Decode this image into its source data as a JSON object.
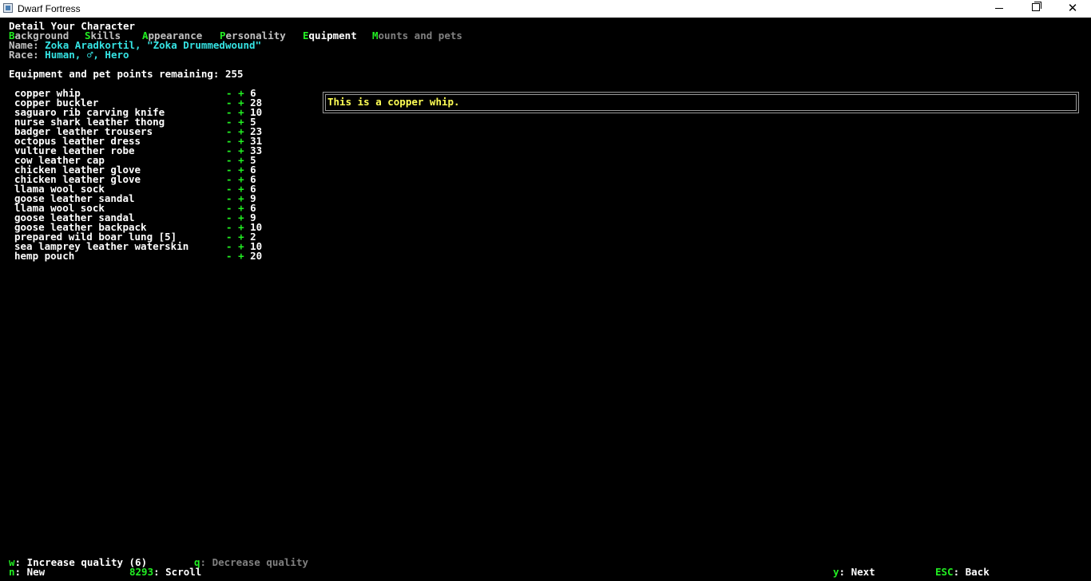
{
  "window": {
    "title": "Dwarf Fortress"
  },
  "header": {
    "title": "Detail Your Character",
    "name_label": "Name:",
    "name_value": "Zoka Aradkortil, \"Zoka Drummedwound\"",
    "race_label": "Race:",
    "race_value": "Human, ♂, Hero",
    "points_label": "Equipment and pet points remaining:",
    "points_value": "255"
  },
  "tabs": [
    {
      "key": "B",
      "rest": "ackground",
      "state": "inactive"
    },
    {
      "key": "S",
      "rest": "kills",
      "state": "inactive"
    },
    {
      "key": "A",
      "rest": "ppearance",
      "state": "inactive"
    },
    {
      "key": "P",
      "rest": "ersonality",
      "state": "inactive"
    },
    {
      "key": "E",
      "rest": "quipment",
      "state": "active"
    },
    {
      "key": "M",
      "rest": "ounts and pets",
      "state": "disabled"
    }
  ],
  "equipment": [
    {
      "name": "copper whip",
      "minus": "-",
      "plus": "+",
      "cost": "6"
    },
    {
      "name": "copper buckler",
      "minus": "-",
      "plus": "+",
      "cost": "28"
    },
    {
      "name": "saguaro rib carving knife",
      "minus": "-",
      "plus": "+",
      "cost": "10"
    },
    {
      "name": "nurse shark leather thong",
      "minus": "-",
      "plus": "+",
      "cost": "5"
    },
    {
      "name": "badger leather trousers",
      "minus": "-",
      "plus": "+",
      "cost": "23"
    },
    {
      "name": "octopus leather dress",
      "minus": "-",
      "plus": "+",
      "cost": "31"
    },
    {
      "name": "vulture leather robe",
      "minus": "-",
      "plus": "+",
      "cost": "33"
    },
    {
      "name": "cow leather cap",
      "minus": "-",
      "plus": "+",
      "cost": "5"
    },
    {
      "name": "chicken leather glove",
      "minus": "-",
      "plus": "+",
      "cost": "6"
    },
    {
      "name": "chicken leather glove",
      "minus": "-",
      "plus": "+",
      "cost": "6"
    },
    {
      "name": "llama wool sock",
      "minus": "-",
      "plus": "+",
      "cost": "6"
    },
    {
      "name": "goose leather sandal",
      "minus": "-",
      "plus": "+",
      "cost": "9"
    },
    {
      "name": "llama wool sock",
      "minus": "-",
      "plus": "+",
      "cost": "6"
    },
    {
      "name": "goose leather sandal",
      "minus": "-",
      "plus": "+",
      "cost": "9"
    },
    {
      "name": "goose leather backpack",
      "minus": "-",
      "plus": "+",
      "cost": "10"
    },
    {
      "name": "prepared wild boar lung [5]",
      "minus": "-",
      "plus": "+",
      "cost": "2"
    },
    {
      "name": "sea lamprey leather waterskin",
      "minus": "-",
      "plus": "+",
      "cost": "10"
    },
    {
      "name": "hemp pouch",
      "minus": "-",
      "plus": "+",
      "cost": "20"
    }
  ],
  "description": "This is a copper whip.",
  "footer": {
    "increase_key": "w",
    "increase_label": ": Increase quality (6)",
    "decrease_key": "q",
    "decrease_label": ": Decrease quality",
    "new_key": "n",
    "new_label": ": New",
    "scroll_key": "8293",
    "scroll_label": ": Scroll",
    "next_key": "y",
    "next_label": ": Next",
    "back_key": "ESC",
    "back_label": ": Back"
  },
  "colors": {
    "background": "#000000",
    "hotkey": "#22ee22",
    "name_value": "#35e3e3",
    "description": "#ffff55",
    "item_text": "#ffffff",
    "disabled": "#808080"
  }
}
